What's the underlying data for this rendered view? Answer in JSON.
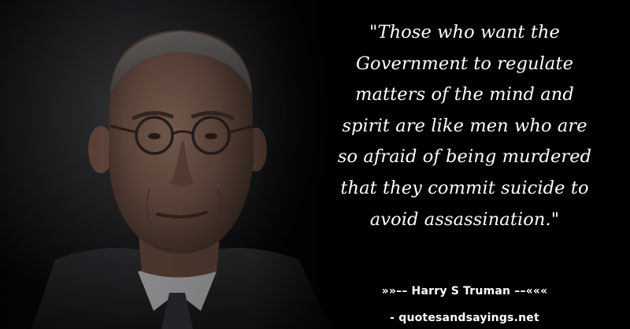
{
  "quote": {
    "text": "\"Those who want the Government to regulate matters of the mind and spirit are like men who are so afraid of being murdered that they commit suicide to avoid assassination.\"",
    "lines": [
      "\"Those who want the",
      "Government to regulate",
      "matters of the mind and",
      "spirit are like men who are",
      "so afraid of being murdered",
      "that they commit suicide to",
      "avoid assassination.\""
    ]
  },
  "attribution": {
    "text": "»»–– Harry S Truman ––«««"
  },
  "site": {
    "text": "- quotesandsayings.net"
  },
  "colors": {
    "background": "#000000",
    "text": "#ffffff"
  }
}
